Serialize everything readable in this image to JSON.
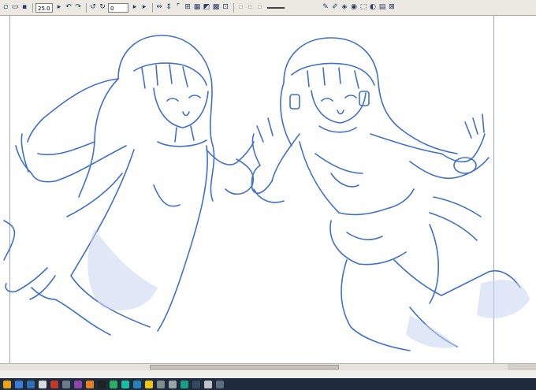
{
  "toolbar": {
    "zoom_value": "25.0",
    "rotation_value": "0",
    "left_icons": [
      "new-icon",
      "open-icon",
      "save-icon",
      "undo-icon",
      "redo-icon",
      "rotate-left-icon",
      "rotate-right-icon"
    ],
    "mid_icons": [
      "flip-horizontal-icon",
      "flip-vertical-icon",
      "fit-icon",
      "fit-width-icon",
      "actual-size-icon",
      "reset-icon",
      "grid-icon",
      "ruler-icon"
    ],
    "right_icons": [
      "pen-icon",
      "brush-icon",
      "eraser-icon",
      "fill-icon",
      "select-icon",
      "transform-icon",
      "layer-icon",
      "close-icon"
    ]
  },
  "taskbar": {
    "icons": [
      {
        "name": "task-icon-1",
        "color": "#e8a317"
      },
      {
        "name": "task-icon-2",
        "color": "#3b7dd8"
      },
      {
        "name": "task-icon-3",
        "color": "#2f6fb2"
      },
      {
        "name": "task-icon-4",
        "color": "#d9d9d9"
      },
      {
        "name": "task-icon-5",
        "color": "#c0392b"
      },
      {
        "name": "task-icon-6",
        "color": "#6c7a89"
      },
      {
        "name": "task-icon-7",
        "color": "#8e44ad"
      },
      {
        "name": "task-icon-8",
        "color": "#e67e22"
      },
      {
        "name": "task-icon-9",
        "color": "#222222"
      },
      {
        "name": "task-icon-10",
        "color": "#27ae60"
      },
      {
        "name": "task-icon-11",
        "color": "#1abc9c"
      },
      {
        "name": "task-icon-12",
        "color": "#2980b9"
      },
      {
        "name": "task-icon-13",
        "color": "#f1c40f"
      },
      {
        "name": "task-icon-14",
        "color": "#7f8c8d"
      },
      {
        "name": "task-icon-15",
        "color": "#95a5a6"
      },
      {
        "name": "task-icon-16",
        "color": "#16a085"
      },
      {
        "name": "task-icon-17",
        "color": "#34495e"
      },
      {
        "name": "task-icon-18",
        "color": "#bdc3c7"
      },
      {
        "name": "task-icon-19",
        "color": "#5d6d7e"
      }
    ]
  },
  "canvas": {
    "stroke_color": "#3f6fd1",
    "shade_color": "#c7d4ef"
  }
}
